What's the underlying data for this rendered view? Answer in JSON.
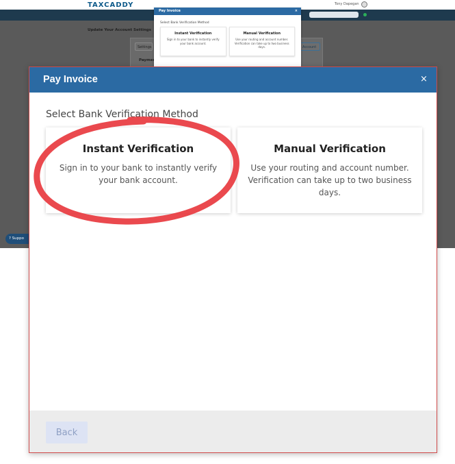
{
  "background": {
    "logo": "TAXCADDY",
    "user_label": "Tony Dapegan",
    "page_heading": "Update Your Account Settings",
    "settings_tab": "Settings",
    "account_tab": "Account",
    "payments_label": "Paymen",
    "support_button": "Suppo",
    "mini_modal": {
      "title": "Pay Invoice",
      "close": "×",
      "subtitle": "Select Bank Verification Method",
      "cards": [
        {
          "title": "Instant Verification",
          "description": "Sign in to your bank to instantly verify your bank account."
        },
        {
          "title": "Manual Verification",
          "description": "Use your routing and account number. Verification can take up to two business days."
        }
      ]
    }
  },
  "modal": {
    "title": "Pay Invoice",
    "close": "×",
    "subtitle": "Select Bank Verification Method",
    "cards": [
      {
        "title": "Instant Verification",
        "description": "Sign in to your bank to instantly verify your bank account."
      },
      {
        "title": "Manual Verification",
        "description": "Use your routing and account number. Verification can take up to two business days."
      }
    ],
    "back_button": "Back"
  },
  "colors": {
    "header": "#2b6aa3",
    "annotation": "#e8393f",
    "back_button_bg": "#dde3f4"
  }
}
